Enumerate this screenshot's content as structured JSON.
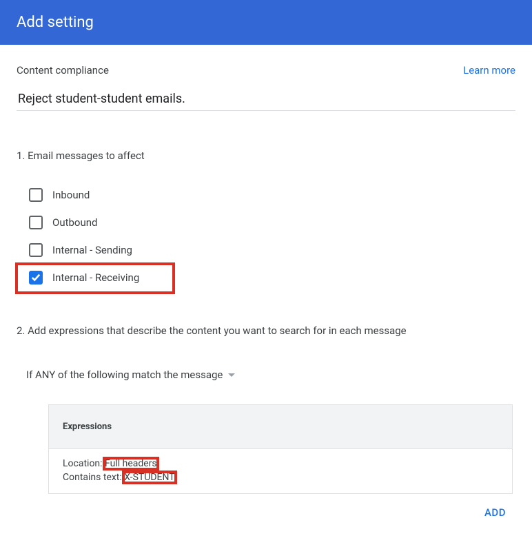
{
  "header": {
    "title": "Add setting"
  },
  "top": {
    "section": "Content compliance",
    "learn_more": "Learn more",
    "description": "Reject student-student emails."
  },
  "q1": {
    "title": "1. Email messages to affect",
    "options": [
      {
        "label": "Inbound",
        "checked": false
      },
      {
        "label": "Outbound",
        "checked": false
      },
      {
        "label": "Internal - Sending",
        "checked": false
      },
      {
        "label": "Internal - Receiving",
        "checked": true,
        "highlighted": true
      }
    ]
  },
  "q2": {
    "title": "2. Add expressions that describe the content you want to search for in each message",
    "match_mode": "If ANY of the following match the message",
    "table_header": "Expressions",
    "row": {
      "loc_label": "Location: ",
      "loc_value": "Full headers",
      "text_label": "Contains text: ",
      "text_value": "X-STUDENT"
    },
    "add_label": "ADD"
  }
}
